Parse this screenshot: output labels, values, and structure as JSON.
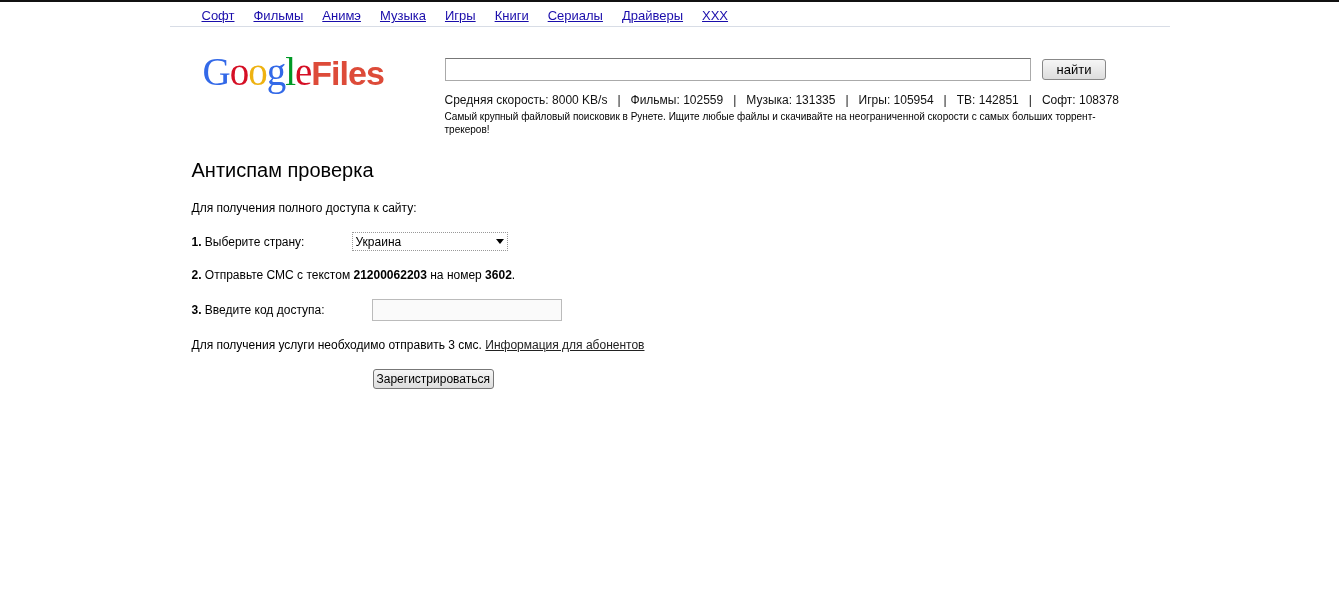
{
  "nav": [
    "Софт",
    "Фильмы",
    "Анимэ",
    "Музыка",
    "Игры",
    "Книги",
    "Сериалы",
    "Драйверы",
    "XXX"
  ],
  "logo": {
    "first": "Google",
    "second": "Files"
  },
  "search": {
    "button": "найти"
  },
  "stats": "Средняя скорость: 8000 KB/s   |   Фильмы: 102559   |   Музыка: 131335   |   Игры: 105954   |   ТВ: 142851   |   Софт: 108378",
  "tagline": "Самый крупный файловый поисковик в Рунете. Ищите любые файлы и скачивайте на неограниченной скорости с самых больших торрент-трекеров!",
  "heading": "Антиспам проверка",
  "intro": "Для получения полного доступа к сайту:",
  "steps": [
    {
      "kind": "select",
      "label": "**1.** Выберите страну:",
      "value": "Украина"
    },
    {
      "kind": "text",
      "label": "**2.** Отправьте СМС с текстом **21200062203** на номер **3602**."
    },
    {
      "kind": "input",
      "label": "**3.** Введите код доступа:"
    }
  ],
  "note": "Для получения услуги необходимо отправить 3 смс.",
  "note_link": "Информация для абонентов",
  "submit": "Зарегистрироваться"
}
